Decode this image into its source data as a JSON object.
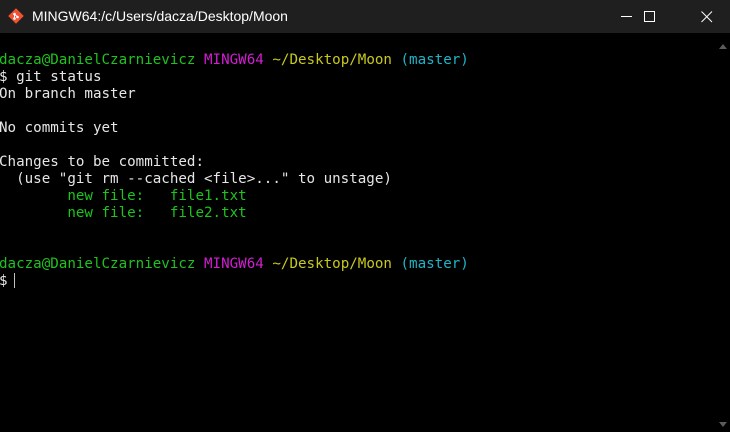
{
  "window": {
    "title": "MINGW64:/c/Users/dacza/Desktop/Moon",
    "icons": {
      "app": "git-bash-icon",
      "minimize": "minimize-icon",
      "maximize": "maximize-icon",
      "close": "close-icon"
    }
  },
  "colors": {
    "background": "#000000",
    "titlebar": "#1f1f1f",
    "user": "#1ec31e",
    "host": "#d21ed2",
    "path": "#c8c81e",
    "branch": "#1eb4c8",
    "text": "#e6e6e6"
  },
  "terminal": {
    "prompt1": {
      "user": "dacza@DanielCzarnievicz",
      "host": "MINGW64",
      "path": "~/Desktop/Moon",
      "branch": "(master)"
    },
    "command": "$ git status",
    "output": {
      "on_branch": "On branch master",
      "no_commits": "No commits yet",
      "changes_header": "Changes to be committed:",
      "hint": "  (use \"git rm --cached <file>...\" to unstage)",
      "files": [
        "        new file:   file1.txt",
        "        new file:   file2.txt"
      ]
    },
    "prompt2": {
      "user": "dacza@DanielCzarnievicz",
      "host": "MINGW64",
      "path": "~/Desktop/Moon",
      "branch": "(master)"
    },
    "input_prompt": "$"
  }
}
